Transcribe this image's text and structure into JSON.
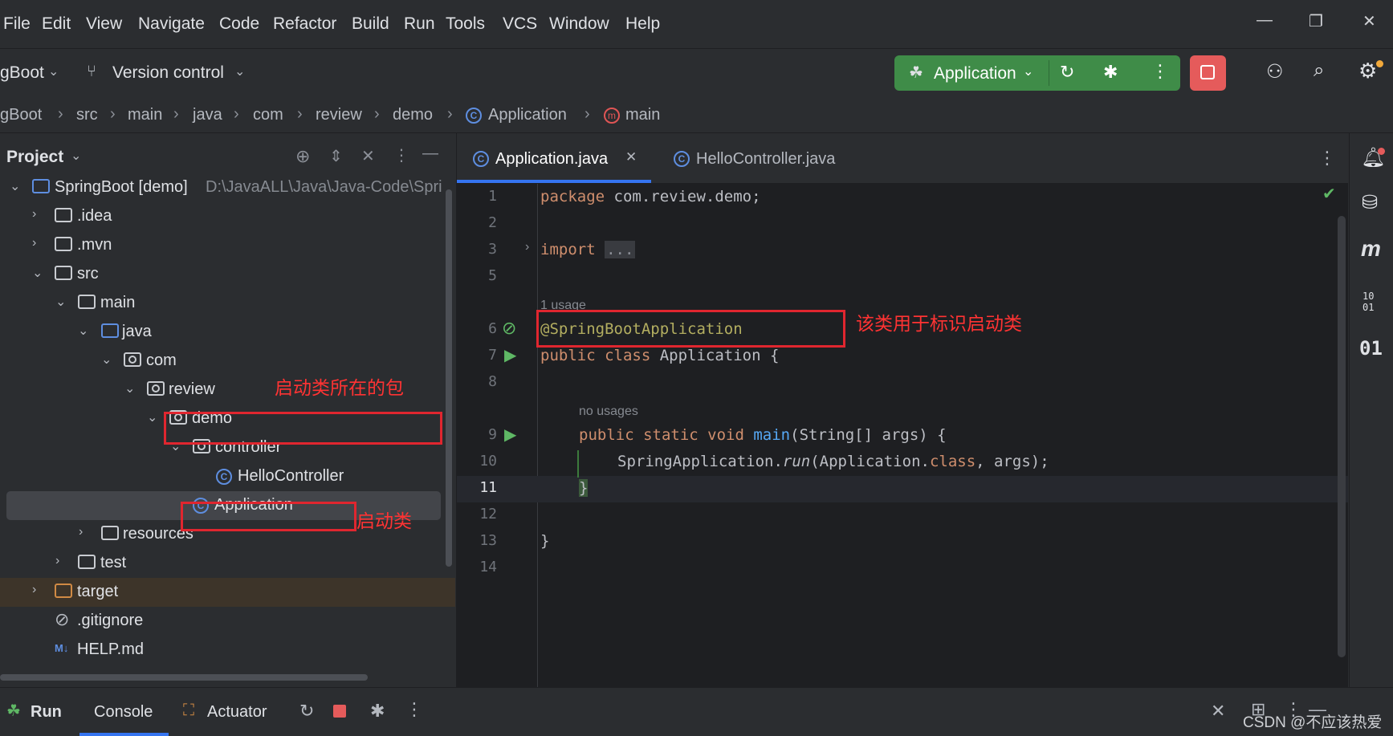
{
  "menu": [
    "File",
    "Edit",
    "View",
    "Navigate",
    "Code",
    "Refactor",
    "Build",
    "Run",
    "Tools",
    "VCS",
    "Window",
    "Help"
  ],
  "toolbar": {
    "project_name": "gBoot",
    "version_control": "Version control",
    "run_config": "Application"
  },
  "breadcrumbs": [
    "gBoot",
    "src",
    "main",
    "java",
    "com",
    "review",
    "demo",
    "Application",
    "main"
  ],
  "project_panel": {
    "title": "Project",
    "root_name": "SpringBoot [demo]",
    "root_path": "D:\\JavaALL\\Java\\Java-Code\\Spri",
    "items": [
      ".idea",
      ".mvn",
      "src",
      "main",
      "java",
      "com",
      "review",
      "demo",
      "controller",
      "HelloController",
      "Application",
      "resources",
      "test",
      "target",
      ".gitignore",
      "HELP.md"
    ]
  },
  "editor": {
    "tabs": [
      "Application.java",
      "HelloController.java"
    ],
    "line_numbers": [
      "1",
      "2",
      "3",
      "5",
      "6",
      "7",
      "8",
      "9",
      "10",
      "11",
      "12",
      "13",
      "14"
    ],
    "usage_hint_1": "1 usage",
    "usage_hint_2": "no usages",
    "code": {
      "l1_kw": "package",
      "l1_rest": " com.review.demo;",
      "l3_kw": "import",
      "l3_fold": "...",
      "l6": "@SpringBootApplication",
      "l7_kw": "public class",
      "l7_rest": " Application {",
      "l9_kw": "public static void",
      "l9_fn": "main",
      "l9_rest": "(String[] args) {",
      "l10_a": "SpringApplication.",
      "l10_run": "run",
      "l10_b": "(Application.",
      "l10_class": "class",
      "l10_c": ", args);",
      "l11": "}",
      "l13": "}"
    }
  },
  "annotations": {
    "package_note": "启动类所在的包",
    "class_note": "启动类",
    "annotation_note": "该类用于标识启动类"
  },
  "bottom_tabs": {
    "run": "Run",
    "console": "Console",
    "actuator": "Actuator"
  },
  "watermark": "CSDN @不应该热爱",
  "colors": {
    "run_button": "#3f8c48",
    "stop_button": "#e55b5b",
    "annotation_red": "#e0262f",
    "selection": "#43454a"
  },
  "icons": [
    "search-icon",
    "gear-icon",
    "bell-icon",
    "database-icon",
    "maven-icon",
    "bug-icon",
    "rerun-icon",
    "stop-icon",
    "user-icon"
  ]
}
